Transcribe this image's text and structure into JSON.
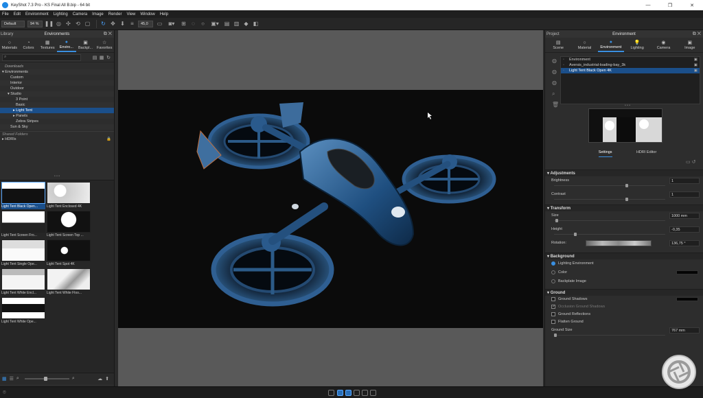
{
  "app": {
    "title": "KeyShot 7.3 Pro  -  KS Final All B.bip  -  64 bit",
    "window_buttons": [
      "—",
      "❐",
      "✕"
    ]
  },
  "menu": [
    "File",
    "Edit",
    "Environment",
    "Lighting",
    "Camera",
    "Image",
    "Render",
    "View",
    "Window",
    "Help"
  ],
  "toolbar": {
    "preset": "Default",
    "zoom": "94 %",
    "fov": "45,0"
  },
  "library": {
    "title": "Library",
    "panel_title": "Environments",
    "tabs": [
      {
        "label": "Materials",
        "icon": "○"
      },
      {
        "label": "Colors",
        "icon": "◔"
      },
      {
        "label": "Textures",
        "icon": "▦"
      },
      {
        "label": "Enviro...",
        "icon": "●"
      },
      {
        "label": "Backpl...",
        "icon": "▣"
      },
      {
        "label": "Favorites",
        "icon": "☆"
      }
    ],
    "tree": [
      {
        "label": "Downloads",
        "indent": 1,
        "style": "italic"
      },
      {
        "label": "Environments",
        "indent": 0,
        "arrow": "▾"
      },
      {
        "label": "Custom",
        "indent": 3
      },
      {
        "label": "Interior",
        "indent": 3
      },
      {
        "label": "Outdoor",
        "indent": 3
      },
      {
        "label": "Studio",
        "indent": 2,
        "arrow": "▾"
      },
      {
        "label": "3 Point",
        "indent": 5
      },
      {
        "label": "Basic",
        "indent": 5
      },
      {
        "label": "Light Tent",
        "indent": 4,
        "arrow": "▸",
        "selected": true
      },
      {
        "label": "Panels",
        "indent": 4,
        "arrow": "▸"
      },
      {
        "label": "Zebra Stripes",
        "indent": 5
      },
      {
        "label": "Sun & Sky",
        "indent": 3
      }
    ],
    "shared_folders": "Shared Folders",
    "hdris": "HDRIs",
    "thumbnails": [
      "Light Tent Black Open...",
      "Light Tent Enclosed 4K",
      "Light Tent Screen Fro...",
      "Light Tent Screen Top ...",
      "Light Tent Single Ope...",
      "Light Tent Spot 4K",
      "Light Tent White Encl...",
      "Light Tent White Floo...",
      "Light Tent White Ope..."
    ]
  },
  "right_panel": {
    "title": "Project",
    "panel_title": "Environment",
    "tabs": [
      {
        "label": "Scene",
        "icon": "▤"
      },
      {
        "label": "Material",
        "icon": "○"
      },
      {
        "label": "Environment",
        "icon": "●"
      },
      {
        "label": "Lighting",
        "icon": "💡"
      },
      {
        "label": "Camera",
        "icon": "◉"
      },
      {
        "label": "Image",
        "icon": "▣"
      }
    ],
    "environments": [
      "Environment",
      "Aversis_industrial-loading-bay_3k",
      "Light Tent Black Open 4K"
    ],
    "subtabs": [
      "Settings",
      "HDRI Editor"
    ],
    "adjustments": {
      "title": "Adjustments",
      "brightness_label": "Brightness",
      "brightness": "1",
      "contrast_label": "Contrast",
      "contrast": "1"
    },
    "transform": {
      "title": "Transform",
      "size_label": "Size",
      "size": "1000 mm",
      "height_label": "Height",
      "height": "-0,35",
      "rotation_label": "Rotation:",
      "rotation": "136,75 °"
    },
    "background": {
      "title": "Background",
      "options": [
        "Lighting Environment",
        "Color",
        "Backplate Image"
      ],
      "selected": 0
    },
    "ground": {
      "title": "Ground",
      "checks": [
        {
          "label": "Ground Shadows",
          "checked": false,
          "disabled": false
        },
        {
          "label": "Occlusion Ground Shadows",
          "checked": true,
          "disabled": true
        },
        {
          "label": "Ground Reflections",
          "checked": false,
          "disabled": false
        },
        {
          "label": "Flatten Ground",
          "checked": false,
          "disabled": false
        }
      ],
      "size_label": "Ground Size",
      "size": "767 mm"
    }
  }
}
